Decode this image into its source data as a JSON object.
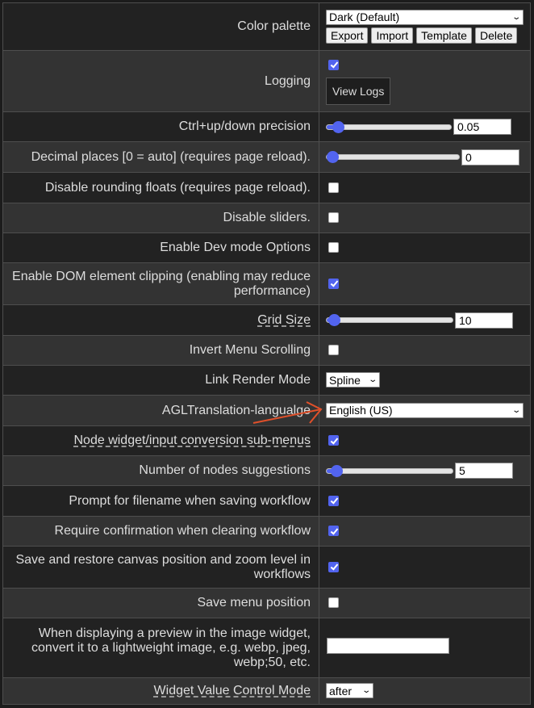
{
  "settings": {
    "color_palette": {
      "label": "Color palette",
      "selected": "Dark (Default)",
      "buttons": [
        "Export",
        "Import",
        "Template",
        "Delete"
      ]
    },
    "logging": {
      "label": "Logging",
      "checked": true,
      "button": "View Logs"
    },
    "ctrl_precision": {
      "label": "Ctrl+up/down precision",
      "value": "0.05",
      "fraction": 0.05
    },
    "decimal_places": {
      "label": "Decimal places [0 = auto] (requires page reload).",
      "value": "0",
      "fraction": 0.0
    },
    "disable_rounding": {
      "label": "Disable rounding floats (requires page reload).",
      "checked": false
    },
    "disable_sliders": {
      "label": "Disable sliders.",
      "checked": false
    },
    "dev_mode": {
      "label": "Enable Dev mode Options",
      "checked": false
    },
    "dom_clipping": {
      "label": "Enable DOM element clipping (enabling may reduce performance)",
      "checked": true
    },
    "grid_size": {
      "label": "Grid Size",
      "value": "10",
      "fraction": 0.02
    },
    "invert_menu_scrolling": {
      "label": "Invert Menu Scrolling",
      "checked": false
    },
    "link_render_mode": {
      "label": "Link Render Mode",
      "selected": "Spline"
    },
    "translation_language": {
      "label": "AGLTranslation-langualge",
      "selected": "English (US)"
    },
    "node_widget_submenus": {
      "label": "Node widget/input conversion sub-menus",
      "checked": true
    },
    "node_suggestions": {
      "label": "Number of nodes suggestions",
      "value": "5",
      "fraction": 0.04
    },
    "prompt_filename": {
      "label": "Prompt for filename when saving workflow",
      "checked": true
    },
    "confirm_clear": {
      "label": "Require confirmation when clearing workflow",
      "checked": true
    },
    "save_canvas": {
      "label": "Save and restore canvas position and zoom level in workflows",
      "checked": true
    },
    "save_menu_position": {
      "label": "Save menu position",
      "checked": false
    },
    "preview_format": {
      "label": "When displaying a preview in the image widget, convert it to a lightweight image, e.g. webp, jpeg, webp;50, etc.",
      "value": ""
    },
    "widget_value_control": {
      "label": "Widget Value Control Mode",
      "selected": "after"
    }
  },
  "colors": {
    "accent": "#5264ef",
    "annotation_arrow": "#e0502a"
  }
}
